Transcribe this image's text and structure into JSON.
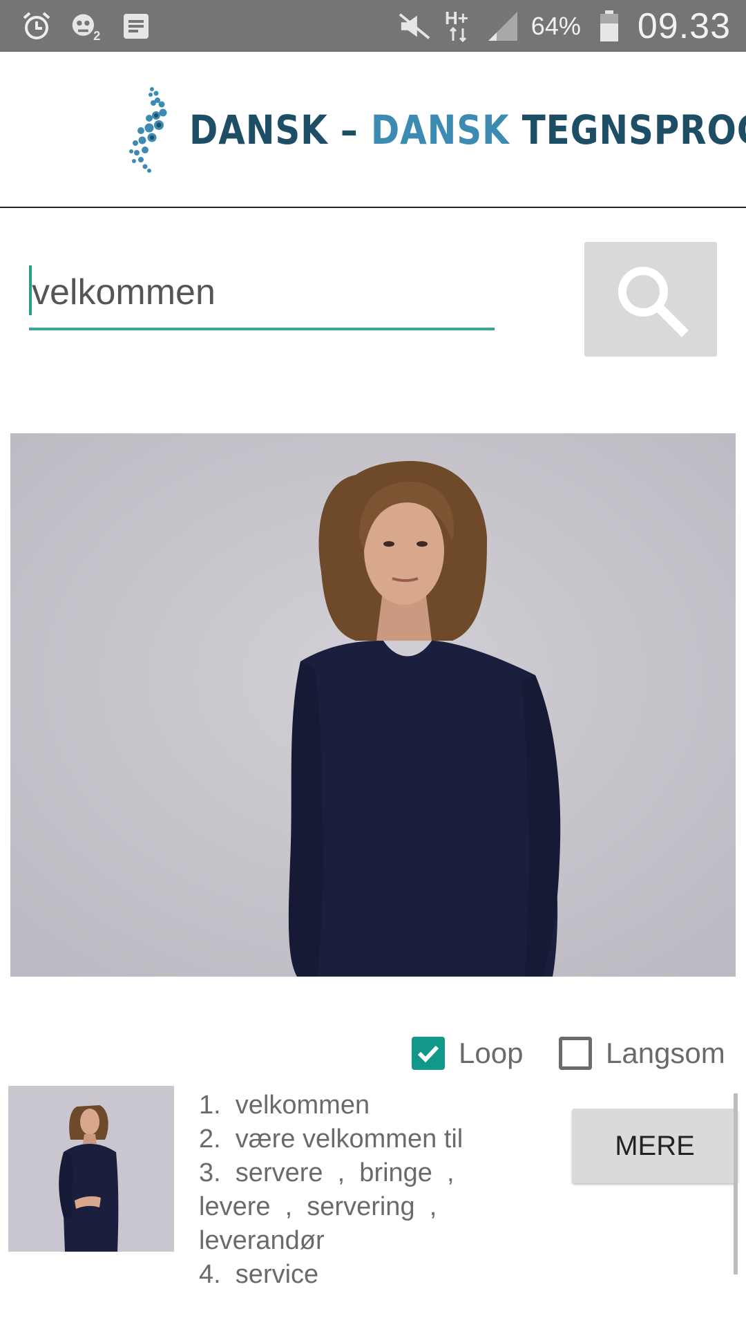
{
  "status_bar": {
    "icons": [
      "alarm-icon",
      "notification-app-icon",
      "notes-icon",
      "mute-icon",
      "network-hplus-icon",
      "signal-icon",
      "battery-icon"
    ],
    "network_type": "H+",
    "battery_percent": "64%",
    "time": "09.33"
  },
  "header": {
    "logo_part1": "DANSK – ",
    "logo_part2": "DANSK",
    "logo_part3": " TEGNSPROG"
  },
  "search": {
    "value": "velkommen",
    "button_icon": "search-icon"
  },
  "video": {
    "description_icon": "sign-language-video"
  },
  "options": {
    "loop": {
      "label": "Loop",
      "checked": true
    },
    "slow": {
      "label": "Langsom",
      "checked": false
    }
  },
  "results": {
    "items": [
      "1.  velkommen",
      "2.  være velkommen til",
      "3.  servere  ,  bringe  ,\nlevere  ,  servering  ,\nleverandør",
      "4.  service"
    ],
    "more_label": "MERE"
  },
  "colors": {
    "accent": "#11988a",
    "status_bar": "#757575",
    "logo_dark": "#1e4e66",
    "logo_light": "#3d8ab3"
  }
}
